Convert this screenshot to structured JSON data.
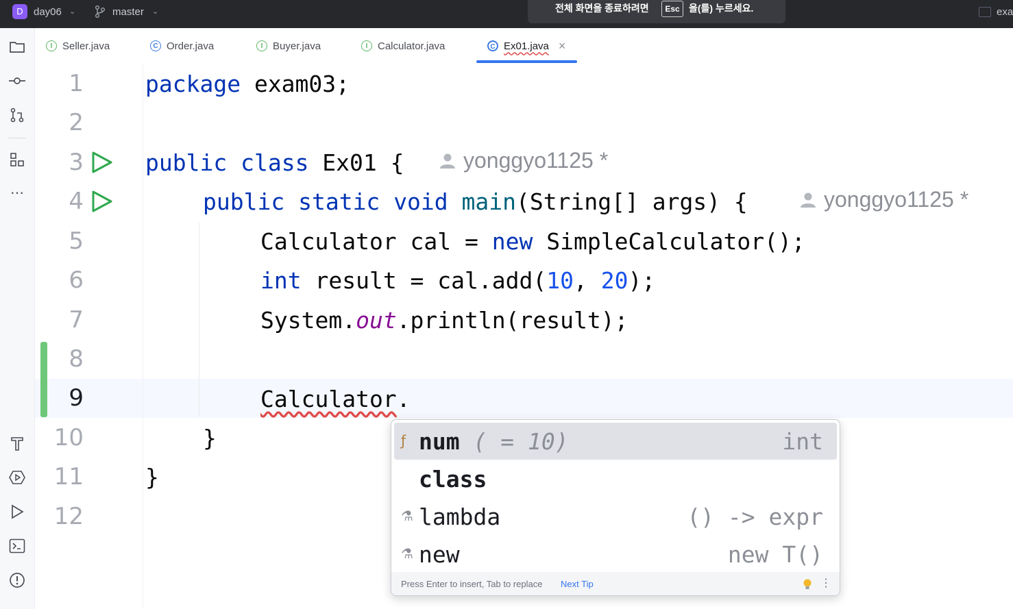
{
  "titlebar": {
    "project_badge": "D",
    "project_name": "day06",
    "branch_name": "master",
    "fullscreen_msg_left": "전체 화면을 종료하려면",
    "fullscreen_msg_key": "Esc",
    "fullscreen_msg_right": "을(를) 누르세요.",
    "right_text": "exa"
  },
  "tabs": [
    {
      "label": "Seller.java",
      "icon": "interface-icon"
    },
    {
      "label": "Order.java",
      "icon": "class-icon"
    },
    {
      "label": "Buyer.java",
      "icon": "interface-icon"
    },
    {
      "label": "Calculator.java",
      "icon": "interface-icon"
    },
    {
      "label": "Ex01.java",
      "icon": "class-run-icon",
      "active": true,
      "close": "×"
    }
  ],
  "lines": [
    "1",
    "2",
    "3",
    "4",
    "5",
    "6",
    "7",
    "8",
    "9",
    "10",
    "11",
    "12"
  ],
  "code": {
    "l1_kw": "package",
    "l1_rest": " exam03;",
    "l3_kw1": "public",
    "l3_kw2": "class",
    "l3_rest": " Ex01 {",
    "author": "yonggyo1125 *",
    "l4_kw1": "public",
    "l4_kw2": "static",
    "l4_kw3": "void",
    "l4_fn": "main",
    "l4_rest": "(String[] args) {",
    "l5_a": "Calculator cal = ",
    "l5_kw": "new",
    "l5_b": " SimpleCalculator();",
    "l6_kw": "int",
    "l6_a": " result = cal.add(",
    "l6_n1": "10",
    "l6_sep": ", ",
    "l6_n2": "20",
    "l6_b": ");",
    "l7_a": "System.",
    "l7_st": "out",
    "l7_b": ".println(result);",
    "l9_err": "Calculator",
    "l9_dot": ".",
    "l10": "}",
    "l11": "}"
  },
  "completion": {
    "items": [
      {
        "name": "num",
        "detail": " ( = 10)",
        "type": "int",
        "icon": "static-field-icon"
      },
      {
        "name": "class",
        "detail": "",
        "type": "",
        "icon": ""
      },
      {
        "name": "lambda",
        "detail": "",
        "type": "() -> expr",
        "icon": "template-icon"
      },
      {
        "name": "new",
        "detail": "",
        "type": "new T()",
        "icon": "template-icon"
      }
    ],
    "footer_text": "Press Enter to insert, Tab to replace",
    "footer_tip": "Next Tip"
  },
  "colors": {
    "keyword": "#0033b3",
    "number": "#1750eb",
    "static_field": "#871094",
    "accent": "#3574f0",
    "run": "#2fa84f",
    "changed": "#6fc879"
  }
}
